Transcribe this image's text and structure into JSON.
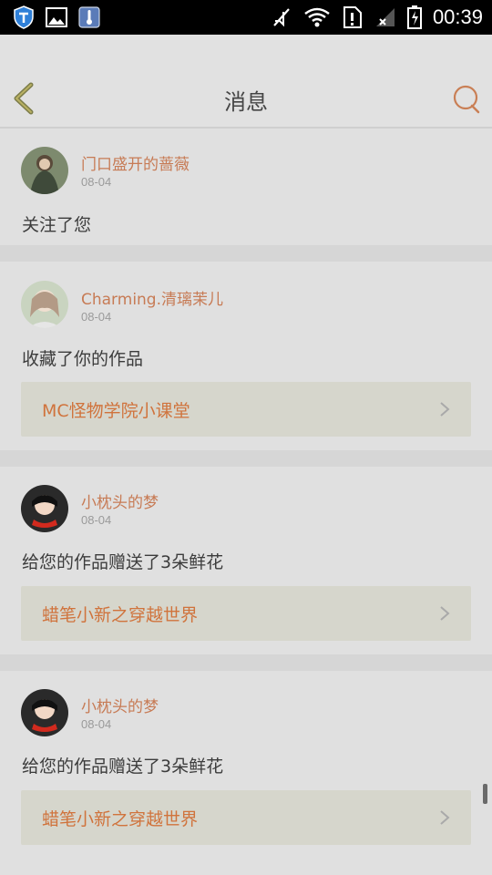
{
  "status_bar": {
    "time": "00:39",
    "icons": [
      "shield-icon",
      "image-icon",
      "thermometer-icon",
      "mute-icon",
      "wifi-icon",
      "sim-icon",
      "signal-icon",
      "battery-icon"
    ]
  },
  "header": {
    "title": "消息",
    "back_icon": "chevron-left-icon",
    "search_icon": "search-icon"
  },
  "colors": {
    "accent": "#c77b55",
    "work_title": "#d0733c",
    "background": "#e0e0e0"
  },
  "messages": [
    {
      "username": "门口盛开的蔷薇",
      "date": "08-04",
      "action": "关注了您",
      "work_title": null
    },
    {
      "username": "Charming.清璃茉儿",
      "date": "08-04",
      "action": "收藏了你的作品",
      "work_title": "MC怪物学院小课堂"
    },
    {
      "username": "小枕头的梦",
      "date": "08-04",
      "action": "给您的作品赠送了3朵鲜花",
      "work_title": "蜡笔小新之穿越世界"
    },
    {
      "username": "小枕头的梦",
      "date": "08-04",
      "action": "给您的作品赠送了3朵鲜花",
      "work_title": "蜡笔小新之穿越世界"
    }
  ]
}
